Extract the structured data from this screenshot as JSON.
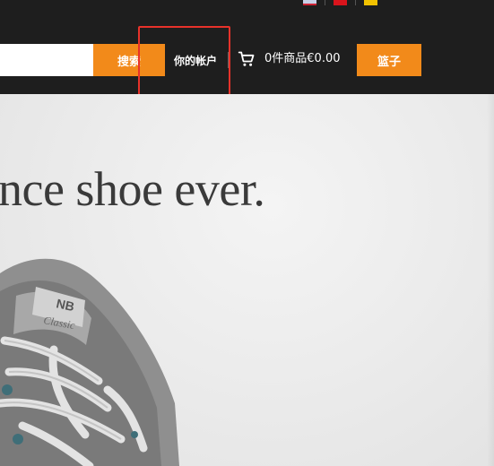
{
  "header": {
    "languages": [
      {
        "code": "en",
        "icon": "uk-flag-icon"
      },
      {
        "code": "zh",
        "icon": "china-flag-icon"
      },
      {
        "code": "de",
        "icon": "germany-flag-icon"
      }
    ],
    "search": {
      "value": "",
      "placeholder": "",
      "button_label": "搜索"
    },
    "account_label": "你的帐户",
    "cart": {
      "icon": "shopping-cart-icon",
      "summary": "0件商品€0.00"
    },
    "basket_label": "篮子",
    "colors": {
      "bar": "#1e1e1e",
      "accent": "#f28a1a",
      "highlight": "#e8322a"
    }
  },
  "hero": {
    "headline": "nce shoe ever.",
    "image": "sneaker-photo"
  }
}
